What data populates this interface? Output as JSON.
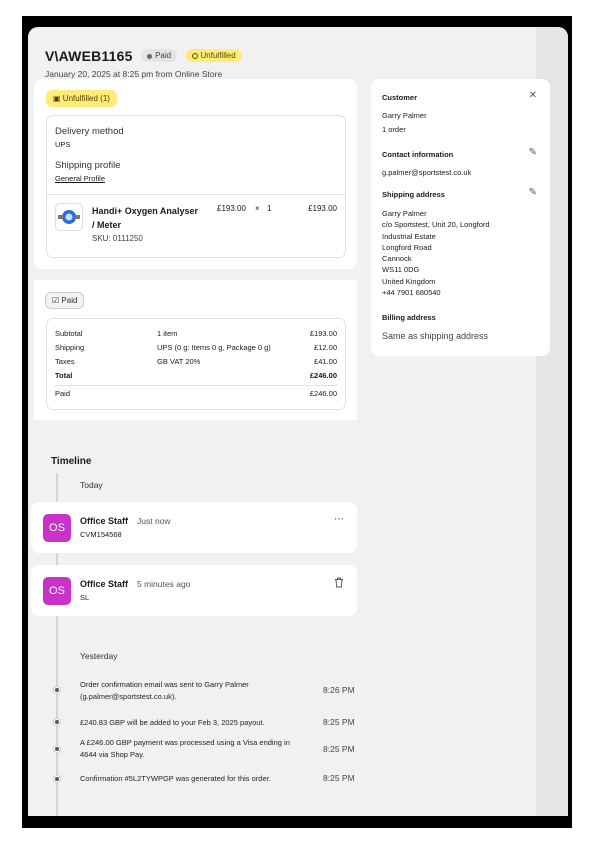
{
  "order": {
    "title": "V\\AWEB1165",
    "badge_paid": "Paid",
    "badge_unfulfilled": "Unfulfilled",
    "subtitle": "January 20, 2025 at 8:25 pm from Online Store"
  },
  "fulfillment": {
    "pill": "Unfulfilled (1)",
    "delivery_label": "Delivery method",
    "delivery_value": "UPS",
    "shipping_profile_label": "Shipping profile",
    "shipping_profile_value": "General Profile",
    "product": {
      "name": "Handi+ Oxygen Analyser / Meter",
      "sku": "SKU: 0111250",
      "price": "£193.00",
      "times": "×",
      "qty": "1",
      "total": "£193.00"
    }
  },
  "payment": {
    "pill": "Paid",
    "rows": [
      {
        "label": "Subtotal",
        "desc": "1 item",
        "amount": "£193.00"
      },
      {
        "label": "Shipping",
        "desc": "UPS (0 g: Items 0 g, Package 0 g)",
        "amount": "£12.00"
      },
      {
        "label": "Taxes",
        "desc": "GB VAT 20%",
        "amount": "£41.00"
      },
      {
        "label": "Total",
        "desc": "",
        "amount": "£246.00"
      },
      {
        "label": "Paid",
        "desc": "",
        "amount": "£246.00"
      }
    ]
  },
  "customer": {
    "heading": "Customer",
    "name": "Garry Palmer",
    "orders": "1 order",
    "contact_heading": "Contact information",
    "email": "g.palmer@sportstest.co.uk",
    "shipping_heading": "Shipping address",
    "address": [
      "Garry Palmer",
      "c/o Sportstest, Unit 20, Longford",
      "Industrial Estate",
      "Longford Road",
      "Cannock",
      "WS11 0DG",
      "United Kingdom",
      "+44 7901 680540"
    ],
    "billing_heading": "Billing address",
    "billing_value": "Same as shipping address"
  },
  "timeline": {
    "title": "Timeline",
    "today": "Today",
    "events": [
      {
        "initials": "OS",
        "name": "Office Staff",
        "time": "Just now",
        "note": "CVM154568"
      },
      {
        "initials": "OS",
        "name": "Office Staff",
        "time": "5 minutes ago",
        "note": "SL"
      }
    ],
    "yesterday": "Yesterday",
    "items": [
      {
        "text": "Order confirmation email was sent to Garry Palmer (g.palmer@sportstest.co.uk).",
        "time": "8:26 PM"
      },
      {
        "text": "£240.83 GBP will be added to your Feb 3, 2025 payout.",
        "time": "8:25 PM"
      },
      {
        "text": "A £246.00 GBP payment was processed using a Visa ending in 4644 via Shop Pay.",
        "time": "8:25 PM"
      },
      {
        "text": "Confirmation #5L2TYWPGP was generated for this order.",
        "time": "8:25 PM"
      }
    ]
  },
  "icons": {
    "close": "close-icon",
    "edit": "pencil-icon",
    "more": "more-horizontal-icon",
    "delete": "trash-icon",
    "fulfill": "box-icon",
    "paid": "check-square-icon"
  },
  "colors": {
    "unfulfilled_badge": "#ffeb78",
    "avatar": "#c832c8",
    "page_bg": "#f1f1f1"
  }
}
